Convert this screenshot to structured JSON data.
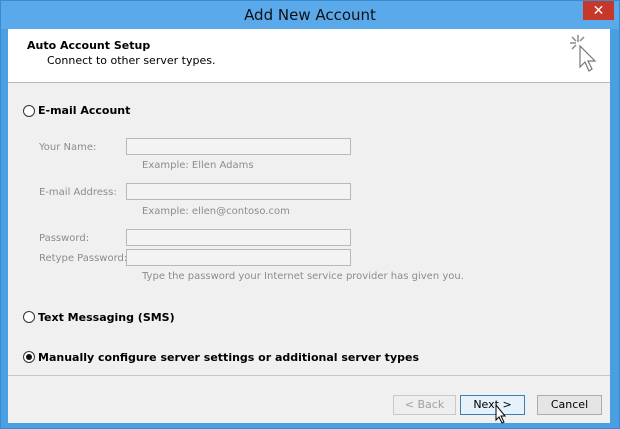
{
  "window": {
    "title": "Add New Account",
    "close_glyph": "✕"
  },
  "header": {
    "title": "Auto Account Setup",
    "subtitle": "Connect to other server types."
  },
  "options": {
    "email": {
      "label": "E-mail Account",
      "selected": false
    },
    "sms": {
      "label": "Text Messaging (SMS)",
      "selected": false
    },
    "manual": {
      "label": "Manually configure server settings or additional server types",
      "selected": true
    }
  },
  "fields": {
    "name": {
      "label": "Your Name:",
      "value": "",
      "hint": "Example: Ellen Adams"
    },
    "email": {
      "label": "E-mail Address:",
      "value": "",
      "hint": "Example: ellen@contoso.com"
    },
    "password": {
      "label": "Password:",
      "value": ""
    },
    "retype": {
      "label": "Retype Password:",
      "value": "",
      "hint": "Type the password your Internet service provider has given you."
    }
  },
  "buttons": {
    "back": "< Back",
    "next": "Next >",
    "cancel": "Cancel"
  },
  "colors": {
    "titlebar": "#5aa9eb",
    "close": "#c7372a",
    "client": "#f0f0f0"
  },
  "icons": {
    "header": "magic-wand-cursor-icon",
    "pointer": "mouse-pointer-icon"
  }
}
